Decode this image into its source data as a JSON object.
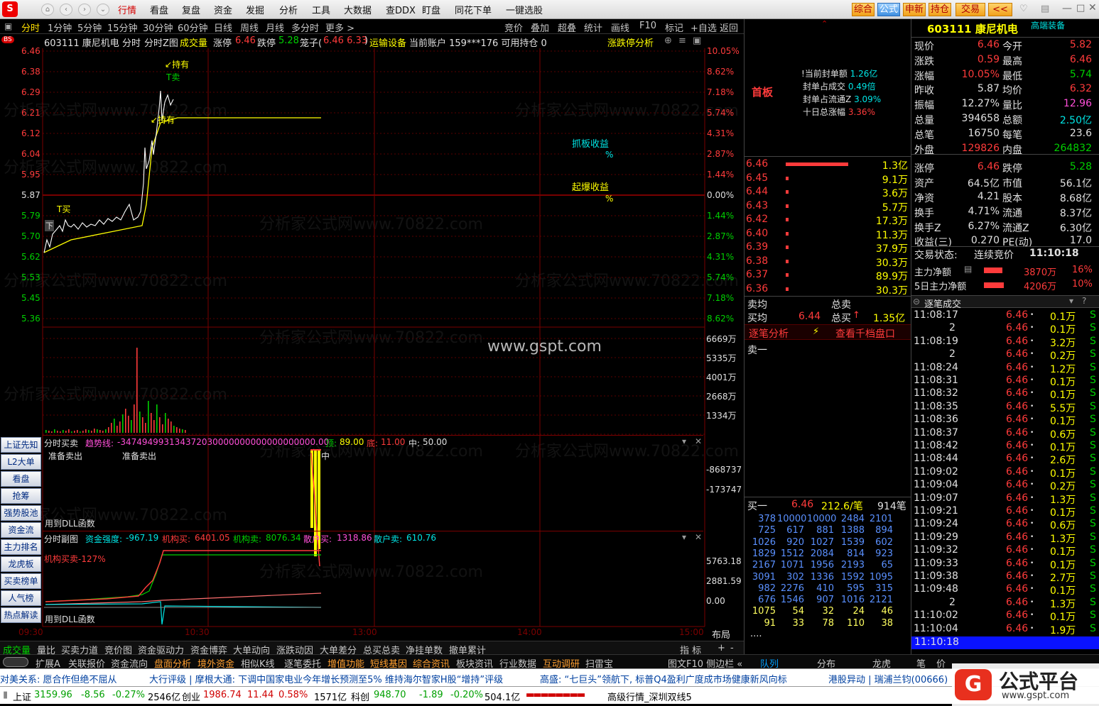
{
  "menubar": {
    "logo": "S",
    "items": [
      "行情",
      "看盘",
      "复盘",
      "资金",
      "发掘",
      "分析",
      "工具",
      "大数据",
      "查DDX",
      "盯盘",
      "同花下单",
      "一键选股"
    ],
    "right_tabs": [
      "综合",
      "公式",
      "申新",
      "持仓",
      "交易",
      "<<"
    ]
  },
  "periodbar": {
    "items": [
      "分时",
      "1分钟",
      "5分钟",
      "15分钟",
      "30分钟",
      "60分钟",
      "日线",
      "周线",
      "月线",
      "多分时",
      "更多 >"
    ],
    "right": [
      "竞价",
      "叠加",
      "超叠",
      "统计",
      "画线",
      "F10",
      "标记",
      "+自选",
      "返回"
    ]
  },
  "chart_header": {
    "badge": "BS",
    "code_name": "603111 康尼机电",
    "label1": "分时",
    "label2": "分时Z图",
    "label3": "成交量",
    "zt_label": "涨停",
    "zt_value": "6.46",
    "dt_label": "跌停",
    "dt_value": "5.28",
    "cage_label": "笼子(",
    "cage_value": "6.46 6.33",
    "cage_close": ")",
    "industry": "运输设备",
    "account": "当前账户 159***176 可用持仓 0",
    "analysis": "涨跌停分析"
  },
  "price_axis": {
    "left": [
      "6.46",
      "6.38",
      "6.29",
      "6.21",
      "6.12",
      "6.04",
      "5.95",
      "5.87",
      "5.79",
      "5.70",
      "5.62",
      "5.53",
      "5.45",
      "5.36"
    ],
    "right": [
      "10.05%",
      "8.62%",
      "7.18%",
      "5.74%",
      "4.31%",
      "2.87%",
      "1.44%",
      "0.00%",
      "1.44%",
      "2.87%",
      "4.31%",
      "5.74%",
      "7.18%",
      "8.62%"
    ]
  },
  "volume_axis": [
    "6669万",
    "5335万",
    "4001万",
    "2668万",
    "1334万"
  ],
  "chart_annotations": {
    "hold1": "持有",
    "tsell": "T卖",
    "hold2": "持有",
    "tbuy": "T买",
    "low_mark": "下",
    "catch_label": "抓板收益",
    "catch_value": "%",
    "burst_label": "起爆收益",
    "burst_value": "%"
  },
  "time_axis": [
    "09:30",
    "10:30",
    "13:00",
    "14:00",
    "15:00"
  ],
  "layout_btn": "布局",
  "sub1": {
    "title": "分时买卖",
    "trend_label": "趋势线:",
    "trend_value": "-347494993134372030000000000000000000.00",
    "top_label": "顶:",
    "top_value": "89.00",
    "bottom_label": "底:",
    "bottom_value": "11.00",
    "mid_label": "中:",
    "mid_value": "50.00",
    "note1": "准备卖出",
    "note2": "准备卖出",
    "mid_mark": "中",
    "axis1": "-868737",
    "axis2": "-173747",
    "dll": "用到DLL函数"
  },
  "sub2": {
    "title": "分时副图",
    "strength_label": "资金强度:",
    "strength_value": "-967.19",
    "inst_buy_label": "机构买:",
    "inst_buy_value": "6401.05",
    "inst_sell_label": "机构卖:",
    "inst_sell_value": "8076.34",
    "retail_buy_label": "散户买:",
    "retail_buy_value": "1318.86",
    "retail_sell_label": "散户卖:",
    "retail_sell_value": "610.76",
    "ratio": "机构买卖-127%",
    "axis1": "5763.18",
    "axis2": "2881.59",
    "axis3": "0.00",
    "dll": "用到DLL函数"
  },
  "left_sidebar": [
    "上证先知",
    "L2大单",
    "看盘",
    "抢筹",
    "强势股池",
    "资金流",
    "主力排名",
    "龙虎板",
    "买卖榜单",
    "人气榜",
    "热点解读"
  ],
  "bottom_tabs": [
    "成交量",
    "量比",
    "买卖力道",
    "竞价图",
    "资金驱动力",
    "资金博弈",
    "大单动向",
    "涨跌动因",
    "大单差分",
    "总买总卖",
    "净挂单数",
    "撤单累计"
  ],
  "bottom_right": [
    "指 标",
    "+",
    "-"
  ],
  "tabs2": [
    "扩展A",
    "关联报价",
    "资金流向",
    "盘面分析",
    "境外资金",
    "相似K线",
    "逐笔委托",
    "增值功能",
    "短线基因",
    "综合资讯",
    "板块资讯",
    "行业数据",
    "互动调研",
    "扫雷宝"
  ],
  "tabs2_right": [
    "图文F10 侧边栏 «",
    "队列",
    "分布",
    "龙虎",
    "笔",
    "价"
  ],
  "limit_panel": {
    "first_board": "首板",
    "rows": [
      {
        "label": "当前封单额",
        "value": "1.26亿"
      },
      {
        "label": "封单占成交",
        "value": "0.49倍"
      },
      {
        "label": "封单占流通Z",
        "value": "3.09%"
      },
      {
        "label": "十日总涨幅",
        "value": "3.36%"
      }
    ]
  },
  "orderbook": {
    "asks": [
      {
        "price": "6.46",
        "vol": "1.3亿"
      },
      {
        "price": "6.45",
        "vol": "9.1万"
      },
      {
        "price": "6.44",
        "vol": "3.6万"
      },
      {
        "price": "6.43",
        "vol": "5.7万"
      },
      {
        "price": "6.42",
        "vol": "17.3万"
      },
      {
        "price": "6.40",
        "vol": "11.3万"
      },
      {
        "price": "6.39",
        "vol": "37.9万"
      },
      {
        "price": "6.38",
        "vol": "30.3万"
      },
      {
        "price": "6.37",
        "vol": "89.9万"
      },
      {
        "price": "6.36",
        "vol": "30.3万"
      }
    ],
    "sell_avg": "卖均",
    "sell_total": "总卖",
    "buy_avg": "买均",
    "buy_avg_value": "6.44",
    "buy_total": "总买",
    "buy_total_value": "1.35亿",
    "detail_btn": "逐笔分析",
    "qian_btn": "查看千档盘口",
    "sell1": "卖一",
    "buy1": "买一",
    "buy1_price": "6.46",
    "buy1_per": "212.6/笔",
    "buy1_count": "914笔",
    "buy1_queue": [
      [
        "378",
        "10000",
        "10000",
        "2484",
        "2101"
      ],
      [
        "725",
        "617",
        "881",
        "1388",
        "894"
      ],
      [
        "1026",
        "920",
        "1027",
        "1539",
        "602"
      ],
      [
        "1829",
        "1512",
        "2084",
        "814",
        "923"
      ],
      [
        "2167",
        "1071",
        "1956",
        "2193",
        "65"
      ],
      [
        "3091",
        "302",
        "1336",
        "1592",
        "1095"
      ],
      [
        "982",
        "2276",
        "410",
        "595",
        "315"
      ],
      [
        "676",
        "1546",
        "907",
        "1016",
        "2121"
      ],
      [
        "1075",
        "54",
        "32",
        "24",
        "46"
      ],
      [
        "91",
        "33",
        "78",
        "110",
        "38"
      ]
    ],
    "more": "...."
  },
  "quote": {
    "title": "603111 康尼机电",
    "tag": "高端装备",
    "rows": [
      [
        "现价",
        "6.46",
        "今开",
        "5.82"
      ],
      [
        "涨跌",
        "0.59",
        "最高",
        "6.46"
      ],
      [
        "涨幅",
        "10.05%",
        "最低",
        "5.74"
      ],
      [
        "昨收",
        "5.87",
        "均价",
        "6.32"
      ],
      [
        "振幅",
        "12.27%",
        "量比",
        "12.96"
      ],
      [
        "总量",
        "394658",
        "总额",
        "2.50亿"
      ],
      [
        "总笔",
        "16750",
        "每笔",
        "23.6"
      ],
      [
        "外盘",
        "129826",
        "内盘",
        "264832"
      ],
      [
        "涨停",
        "6.46",
        "跌停",
        "5.28"
      ],
      [
        "资产",
        "64.5亿",
        "市值",
        "56.1亿"
      ],
      [
        "净资",
        "4.21",
        "股本",
        "8.68亿"
      ],
      [
        "换手",
        "4.71%",
        "流通",
        "8.37亿"
      ],
      [
        "换手Z",
        "6.27%",
        "流通Z",
        "6.30亿"
      ],
      [
        "收益(三)",
        "0.270",
        "PE(动)",
        "17.0"
      ]
    ],
    "status_label": "交易状态:",
    "status_value": "连续竞价",
    "status_time": "11:10:18",
    "main_net_label": "主力净额",
    "main_net_value": "3870万",
    "main_net_pct": "16%",
    "main5_label": "5日主力净额",
    "main5_value": "4206万",
    "main5_pct": "10%",
    "ticks_title": "逐笔成交",
    "ticks": [
      [
        "11:08:17",
        "6.46",
        "0.1万"
      ],
      [
        "2",
        "6.46",
        "0.1万"
      ],
      [
        "11:08:19",
        "6.46",
        "3.2万"
      ],
      [
        "2",
        "6.46",
        "0.2万"
      ],
      [
        "11:08:24",
        "6.46",
        "1.2万"
      ],
      [
        "11:08:31",
        "6.46",
        "0.1万"
      ],
      [
        "11:08:32",
        "6.46",
        "0.1万"
      ],
      [
        "11:08:35",
        "6.46",
        "5.5万"
      ],
      [
        "11:08:36",
        "6.46",
        "0.1万"
      ],
      [
        "11:08:37",
        "6.46",
        "0.6万"
      ],
      [
        "11:08:42",
        "6.46",
        "0.1万"
      ],
      [
        "11:08:44",
        "6.46",
        "2.6万"
      ],
      [
        "11:09:02",
        "6.46",
        "0.1万"
      ],
      [
        "11:09:04",
        "6.46",
        "0.2万"
      ],
      [
        "11:09:07",
        "6.46",
        "1.3万"
      ],
      [
        "11:09:21",
        "6.46",
        "0.1万"
      ],
      [
        "11:09:24",
        "6.46",
        "0.6万"
      ],
      [
        "11:09:29",
        "6.46",
        "1.3万"
      ],
      [
        "11:09:32",
        "6.46",
        "0.1万"
      ],
      [
        "11:09:33",
        "6.46",
        "0.1万"
      ],
      [
        "11:09:38",
        "6.46",
        "2.7万"
      ],
      [
        "11:09:48",
        "6.46",
        "0.1万"
      ],
      [
        "2",
        "6.46",
        "1.3万"
      ],
      [
        "11:10:02",
        "6.46",
        "0.1万"
      ],
      [
        "11:10:04",
        "6.46",
        "1.9万"
      ],
      [
        "11:10:18",
        "6.46",
        "0.1万"
      ]
    ],
    "tick_flag": "S"
  },
  "news": {
    "items": [
      "对美关系: 愿合作但绝不屈从",
      "大行评级 | 摩根大通: 下调中国家电业今年增长预测至5% 维持海尔智家H股“增持”评级",
      "高盛: “七巨头”领航下, 标普Q4盈利广度成市场健康新风向标",
      "港股异动 | 瑞浦兰钧(00666)"
    ]
  },
  "status": {
    "sh_label": "上证",
    "sh_value": "3159.96",
    "sh_chg": "-8.56",
    "sh_pct": "-0.27%",
    "sh_amt": "2546亿",
    "cy_label": "创业",
    "cy_value": "1986.74",
    "cy_chg": "11.44",
    "cy_pct": "0.58%",
    "cy_amt": "1571亿",
    "kc_label": "科创",
    "kc_value": "948.70",
    "kc_chg": "-1.89",
    "kc_pct": "-0.20%",
    "kc_amt": "504.1亿",
    "feed": "高级行情_深圳双线5"
  },
  "watermark": {
    "site": "www.gspt.com",
    "brand": "公式平台",
    "brand_url": "www.gspt.com",
    "bg": "分析家公式网www.70822.com"
  },
  "colors": {
    "up": "#ff3b3b",
    "down": "#00d000",
    "price_line": "#ffffff",
    "avg_line": "#ffff00",
    "grid": "#7a0000"
  }
}
